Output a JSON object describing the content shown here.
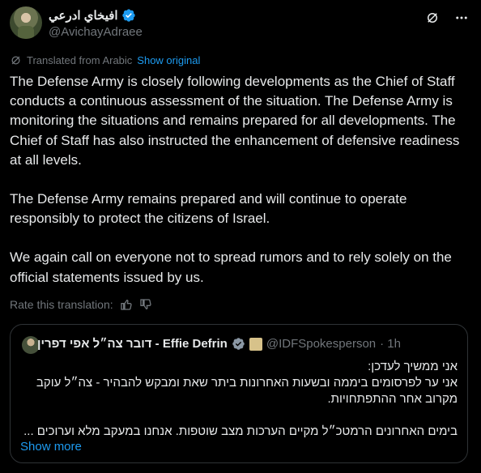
{
  "author": {
    "display_name": "افيخاي ادرعي",
    "handle": "@AvichayAdraee"
  },
  "translation": {
    "label": "Translated from Arabic",
    "show_original": "Show original"
  },
  "post": {
    "paragraphs": [
      "The Defense Army is closely following developments as the Chief of Staff conducts a continuous assessment of the situation. The Defense Army is monitoring the situations and remains prepared for all developments. The Chief of Staff has also instructed the enhancement of defensive readiness at all levels.",
      "The Defense Army remains prepared and will continue to operate responsibly to protect the citizens of Israel.",
      "We again call on everyone not to spread rumors and to rely solely on the official statements issued by us."
    ]
  },
  "rate": {
    "label": "Rate this translation:"
  },
  "quote": {
    "display_name": "דובר צה״ל אפי דפרין - Effie Defrin",
    "handle": "@IDFSpokesperson",
    "time": "· 1h",
    "lines": [
      "אני ממשיך לעדכן:",
      "אני ער לפרסומים ביממה ובשעות האחרונות ביתר שאת ומבקש להבהיר - צה״ל עוקב",
      "מקרוב אחר ההתפתחויות.",
      "",
      "בימים האחרונים הרמטכ״ל מקיים הערכות מצב שוטפות. אנחנו במעקב מלא וערוכים ..."
    ],
    "show_more": "Show more"
  },
  "colors": {
    "accent": "#1d9bf0",
    "muted": "#71767b",
    "border": "#2f3336"
  },
  "icons": [
    "verified-badge-icon",
    "grok-icon",
    "more-icon",
    "translate-icon",
    "thumbs-up-icon",
    "thumbs-down-icon",
    "emblem-icon"
  ]
}
